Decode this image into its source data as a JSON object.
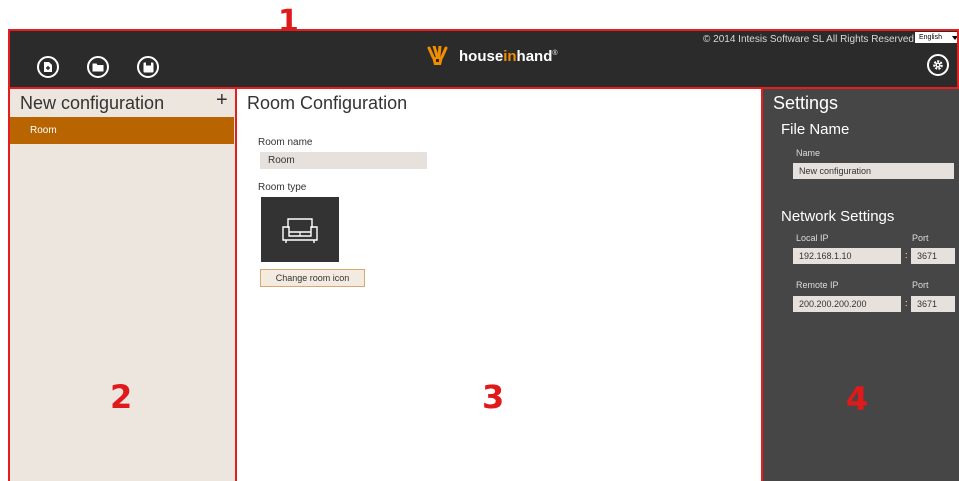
{
  "annotations": {
    "n1": "1",
    "n2": "2",
    "n3": "3",
    "n4": "4"
  },
  "topbar": {
    "copyright": "© 2014 Intesis Software SL All Rights Reserved",
    "language": "English",
    "logo": {
      "house": "house",
      "in": "in",
      "hand": "hand",
      "tm": "®"
    },
    "icons": [
      "new-file-icon",
      "open-folder-icon",
      "save-icon",
      "gear-icon"
    ]
  },
  "left": {
    "title": "New configuration",
    "add": "+",
    "items": [
      "Room"
    ]
  },
  "middle": {
    "title": "Room Configuration",
    "room_name_label": "Room name",
    "room_name_value": "Room",
    "room_type_label": "Room type",
    "room_icon": "sofa-icon",
    "change_button": "Change room icon"
  },
  "settings": {
    "title": "Settings",
    "file_name_title": "File Name",
    "name_label": "Name",
    "name_value": "New configuration",
    "network_title": "Network Settings",
    "local_ip_label": "Local IP",
    "local_ip_value": "192.168.1.10",
    "local_port_label": "Port",
    "local_port_value": "3671",
    "remote_ip_label": "Remote IP",
    "remote_ip_value": "200.200.200.200",
    "remote_port_label": "Port",
    "remote_port_value": "3671",
    "sep": ":"
  },
  "colors": {
    "accent": "#b86400",
    "logo_accent": "#f28c00",
    "topbar": "#2b2b2b",
    "settings_bg": "#464646",
    "sidebar_bg": "#ece6df",
    "annotation": "#e0191b"
  }
}
